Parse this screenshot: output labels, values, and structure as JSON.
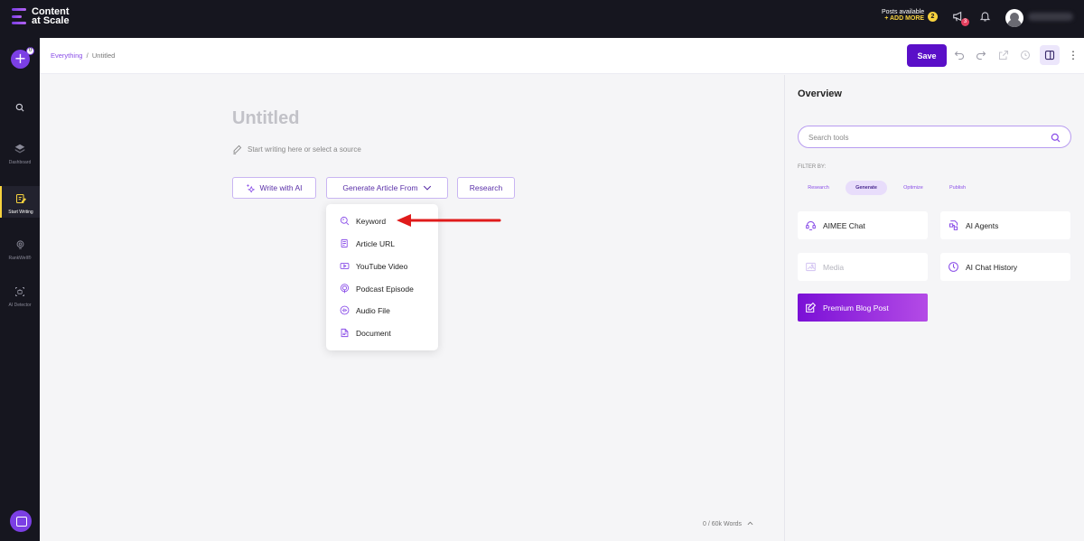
{
  "topbar": {
    "brand_line1": "Content",
    "brand_line2": "at Scale",
    "posts_available_label": "Posts available",
    "add_more_label": "+ ADD MORE",
    "posts_count": "2",
    "announcements_count": "3"
  },
  "sidebar": {
    "new_badge": "0",
    "items": [
      {
        "label": "",
        "icon": "search-icon"
      },
      {
        "label": "Dashboard",
        "icon": "dashboard-icon"
      },
      {
        "label": "Start Writing",
        "icon": "start-writing-icon",
        "active": true
      },
      {
        "label": "RankWell®",
        "icon": "rankwell-icon"
      },
      {
        "label": "AI Detector",
        "icon": "ai-detector-icon"
      }
    ]
  },
  "header": {
    "breadcrumb_root": "Everything",
    "breadcrumb_separator": "/",
    "breadcrumb_current": "Untitled",
    "save_label": "Save"
  },
  "editor": {
    "title_placeholder": "Untitled",
    "hint": "Start writing here or select a source",
    "write_with_ai": "Write with AI",
    "generate_from": "Generate Article From",
    "research": "Research",
    "dropdown": [
      "Keyword",
      "Article URL",
      "YouTube Video",
      "Podcast Episode",
      "Audio File",
      "Document"
    ],
    "word_count": "0 / 60k Words"
  },
  "overview": {
    "title": "Overview",
    "search_placeholder": "Search tools",
    "filter_label": "FILTER BY:",
    "filters": [
      "Research",
      "Generate",
      "Optimize",
      "Publish"
    ],
    "active_filter": "Generate",
    "tools": {
      "aimee_chat": "AIMEE Chat",
      "ai_agents": "AI Agents",
      "media": "Media",
      "ai_chat_history": "AI Chat History",
      "premium_blog_post": "Premium Blog Post"
    }
  },
  "colors": {
    "brand_purple": "#5a0fc8",
    "accent_purple": "#8a4ee8",
    "topbar_bg": "#16161f",
    "badge_yellow": "#f7d23e",
    "badge_red": "#e4405f",
    "annotation_red": "#e01b1b"
  }
}
